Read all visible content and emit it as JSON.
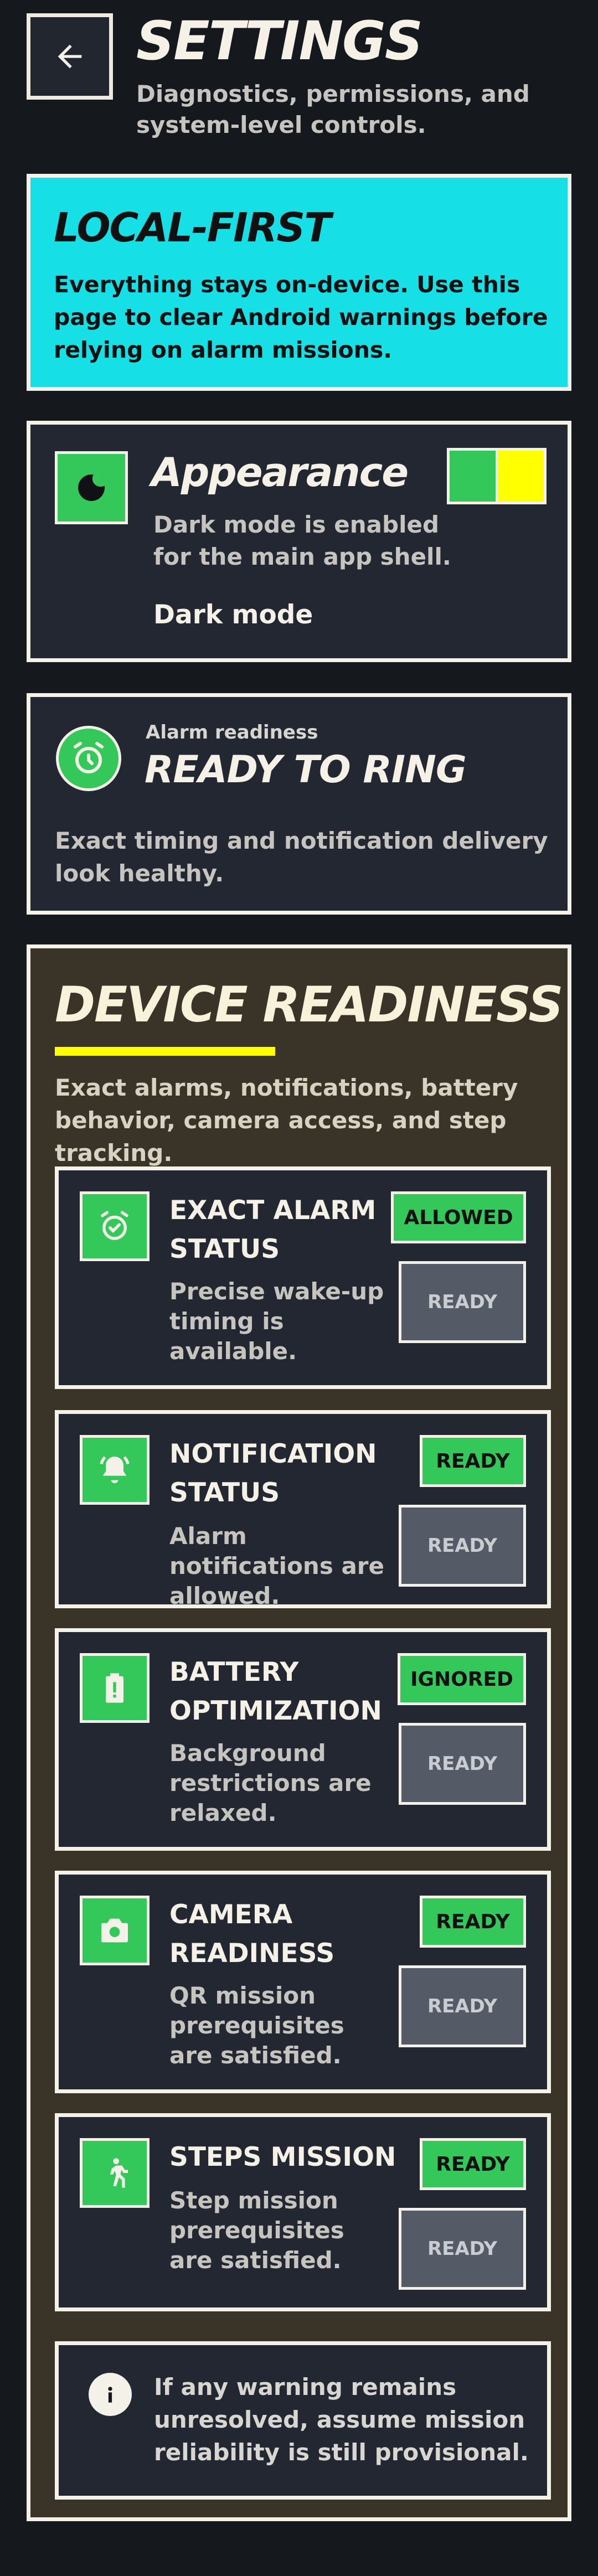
{
  "header": {
    "title": "SETTINGS",
    "subtitle": "Diagnostics, permissions, and system-level controls.",
    "back_icon": "arrow-left-icon"
  },
  "local_first": {
    "title": "LOCAL-FIRST",
    "text": "Everything stays on-device. Use this page to clear Android warnings before relying on alarm missions.",
    "color": "#16dfe6"
  },
  "appearance": {
    "title": "Appearance",
    "description": "Dark mode is enabled for the main app shell.",
    "mode_label": "Dark mode",
    "icon": "moon-icon",
    "swatch_colors": [
      "#34c759",
      "#ffff00"
    ]
  },
  "alarm_readiness": {
    "eyebrow": "Alarm readiness",
    "title": "READY TO RING",
    "description": "Exact timing and notification delivery look healthy.",
    "icon": "alarm-clock-icon"
  },
  "device_readiness": {
    "title": "DEVICE READINESS",
    "description": "Exact alarms, notifications, battery behavior, camera access, and step tracking.",
    "items": [
      {
        "title": "EXACT ALARM STATUS",
        "description": "Precise wake-up timing is available.",
        "badge": "ALLOWED",
        "action": "READY",
        "icon": "alarm-check-icon"
      },
      {
        "title": "NOTIFICATION STATUS",
        "description": "Alarm notifications are allowed.",
        "badge": "READY",
        "action": "READY",
        "icon": "bell-ring-icon"
      },
      {
        "title": "BATTERY OPTIMIZATION",
        "description": "Background restrictions are relaxed.",
        "badge": "IGNORED",
        "action": "READY",
        "icon": "battery-alert-icon"
      },
      {
        "title": "CAMERA READINESS",
        "description": "QR mission prerequisites are satisfied.",
        "badge": "READY",
        "action": "READY",
        "icon": "camera-icon"
      },
      {
        "title": "STEPS MISSION",
        "description": "Step mission prerequisites are satisfied.",
        "badge": "READY",
        "action": "READY",
        "icon": "walking-icon"
      }
    ],
    "info_text": "If any warning remains unresolved, assume mission reliability is still provisional.",
    "accent": "#ffff00"
  }
}
